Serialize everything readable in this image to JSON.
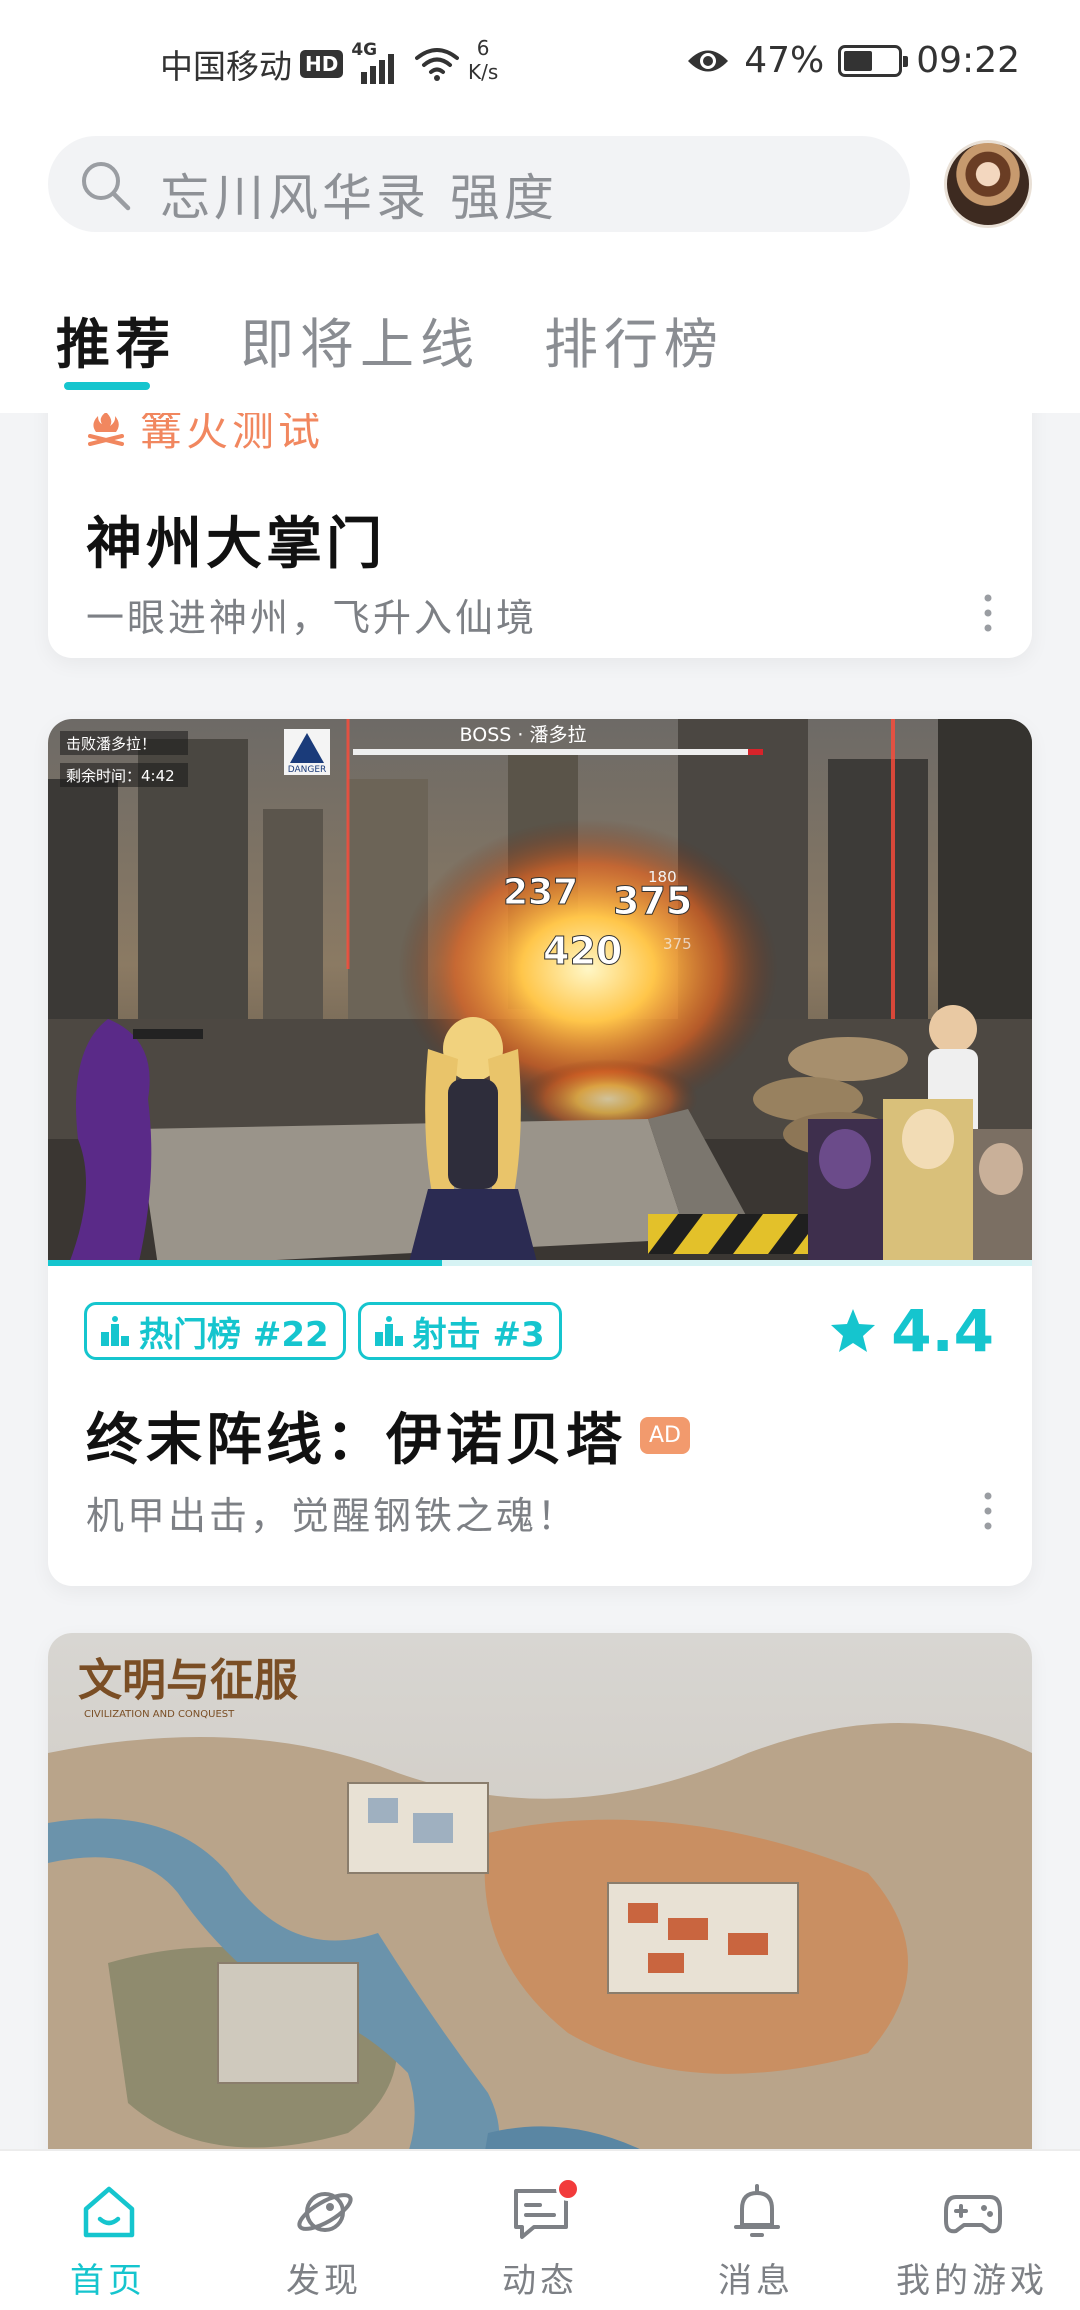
{
  "status_bar": {
    "carrier": "中国移动",
    "hd": "HD",
    "network": "4G",
    "net_speed_value": "6",
    "net_speed_unit": "K/s",
    "battery": "47%",
    "battery_level": 0.47,
    "time": "09:22"
  },
  "header": {
    "search_placeholder": "忘川风华录 强度",
    "tabs": [
      {
        "label": "推荐",
        "active": true
      },
      {
        "label": "即将上线",
        "active": false
      },
      {
        "label": "排行榜",
        "active": false
      }
    ]
  },
  "feed": {
    "cards": [
      {
        "tag": "篝火测试",
        "title": "神州大掌门",
        "subtitle": "一眼进神州，飞升入仙境"
      },
      {
        "screenshot_texts": {
          "mission": "击败潘多拉！",
          "timer": "剩余时间：4:42",
          "danger": "DANGER",
          "boss": "BOSS · 潘多拉",
          "damage_1": "237",
          "damage_2": "375",
          "damage_3": "420",
          "damage_4": "180",
          "damage_5": "375"
        },
        "video_progress": 0.4,
        "badges": [
          "热门榜 #22",
          "射击 #3"
        ],
        "rating": "4.4",
        "title": "终末阵线：伊诺贝塔",
        "ad_label": "AD",
        "subtitle": "机甲出击，觉醒钢铁之魂！"
      },
      {
        "logo_text": "文明与征服",
        "logo_subtext": "CIVILIZATION AND CONQUEST"
      }
    ]
  },
  "bottom_nav": {
    "items": [
      {
        "label": "首页",
        "icon": "home-icon",
        "active": true
      },
      {
        "label": "发现",
        "icon": "planet-icon",
        "active": false
      },
      {
        "label": "动态",
        "icon": "chat-icon",
        "active": false,
        "badge_dot": true
      },
      {
        "label": "消息",
        "icon": "bell-icon",
        "active": false
      },
      {
        "label": "我的游戏",
        "icon": "gamepad-icon",
        "active": false
      }
    ]
  },
  "colors": {
    "accent": "#15c5ce",
    "tag_orange": "#f1875f",
    "ad_orange": "#f29a6d",
    "notif_red": "#f23b3b"
  }
}
